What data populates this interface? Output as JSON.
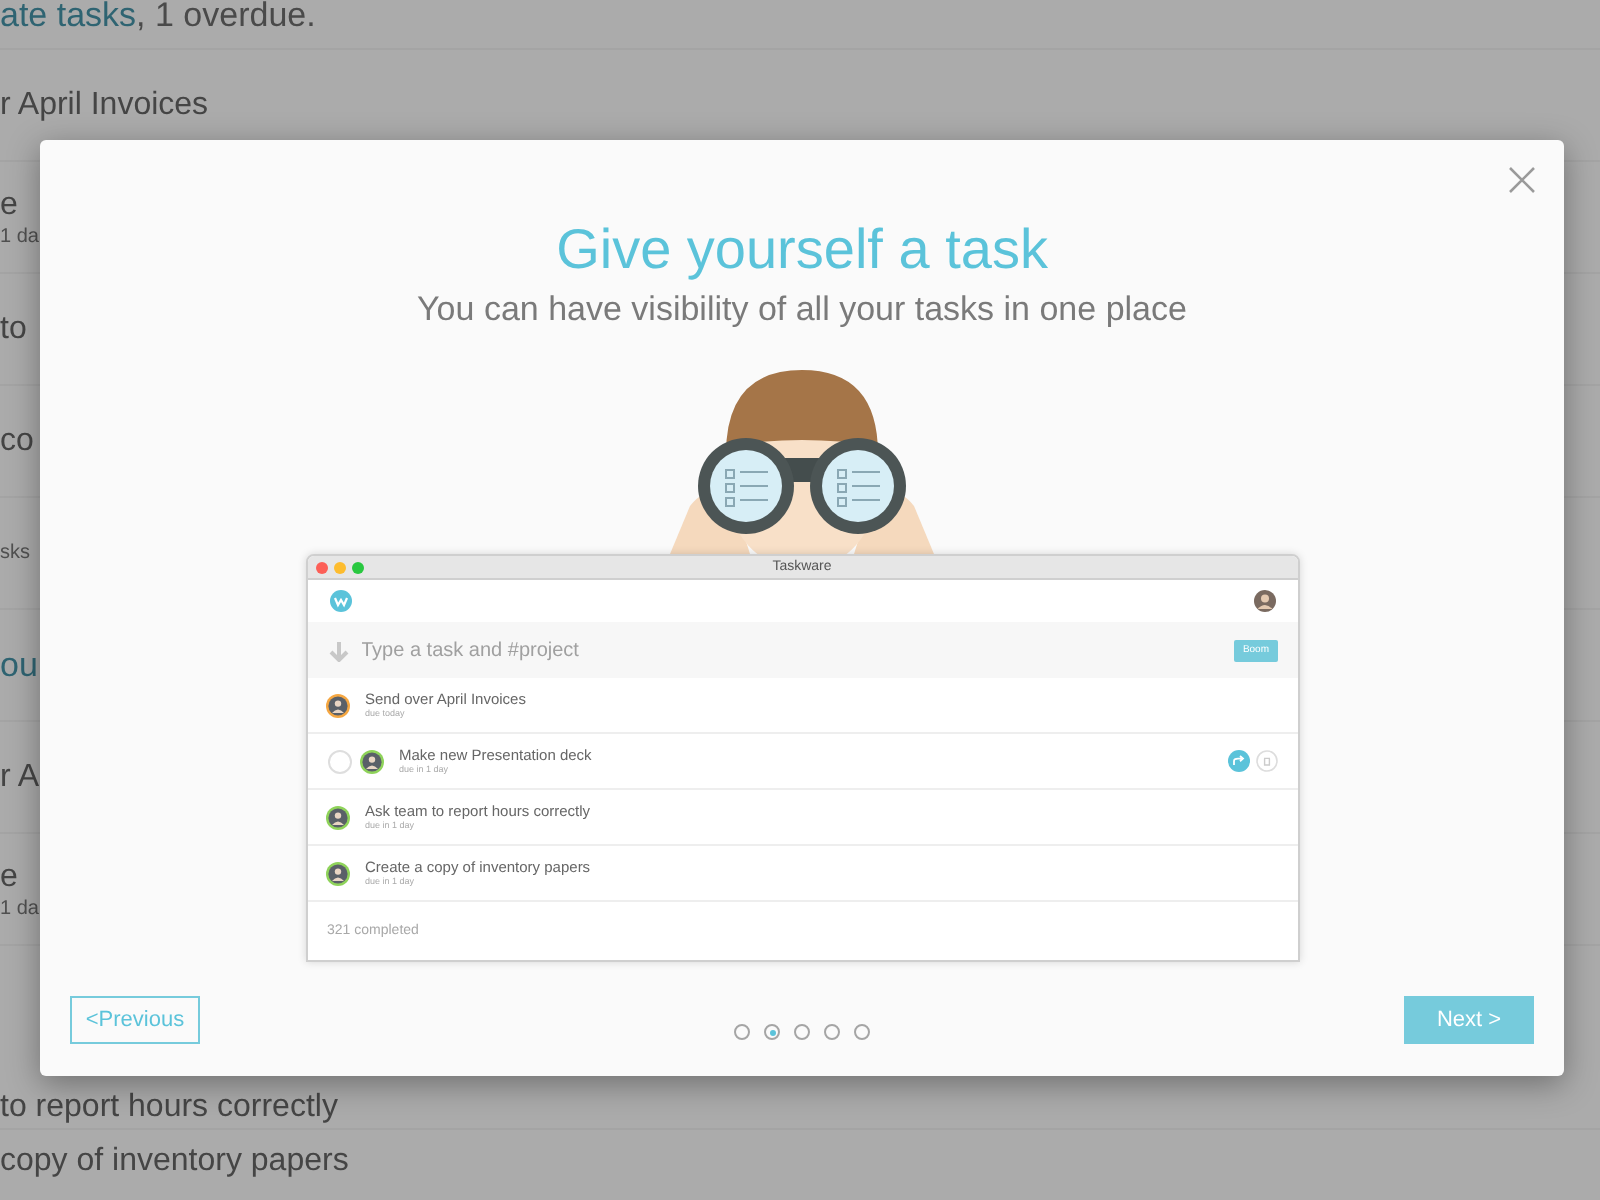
{
  "background": {
    "summary_link": "ate tasks",
    "summary_rest": ", 1 overdue.",
    "rows": [
      {
        "kind": "task",
        "title": "r April Invoices"
      },
      {
        "kind": "task",
        "title": "e",
        "due": "1 da"
      },
      {
        "kind": "task",
        "title": "to"
      },
      {
        "kind": "task",
        "title": "co"
      },
      {
        "kind": "task",
        "due": "sks"
      },
      {
        "kind": "heading",
        "title": "ou"
      },
      {
        "kind": "task",
        "title": "r A"
      },
      {
        "kind": "task",
        "title": "e",
        "due": "1 da"
      },
      {
        "kind": "task",
        "title": "to report hours correctly"
      },
      {
        "kind": "task",
        "title": "copy of inventory papers"
      }
    ]
  },
  "dialog": {
    "title": "Give yourself a task",
    "subtitle": "You can have visibility of all your tasks in one place",
    "app_window": {
      "title": "Taskware",
      "input": {
        "placeholder": "Type a task and #project"
      },
      "add_button": "Boom",
      "tasks": [
        {
          "title": "Send over April Invoices",
          "due": "due today",
          "color": "#f5a742",
          "hovered": false
        },
        {
          "title": "Make new Presentation deck",
          "due": "due in 1 day",
          "color": "#8fd35a",
          "hovered": true,
          "checked": false
        },
        {
          "title": "Ask team to report hours correctly",
          "due": "due in 1 day",
          "color": "#8fd35a",
          "hovered": false
        },
        {
          "title": "Create a copy of inventory papers",
          "due": "due in 1 day",
          "color": "#8fd35a",
          "hovered": false
        }
      ],
      "completed": "321 completed"
    },
    "previous_button": "<Previous",
    "next_button": "Next >",
    "pages": [
      {
        "selected": false
      },
      {
        "selected": true
      },
      {
        "selected": false
      },
      {
        "selected": false
      },
      {
        "selected": false
      }
    ]
  }
}
